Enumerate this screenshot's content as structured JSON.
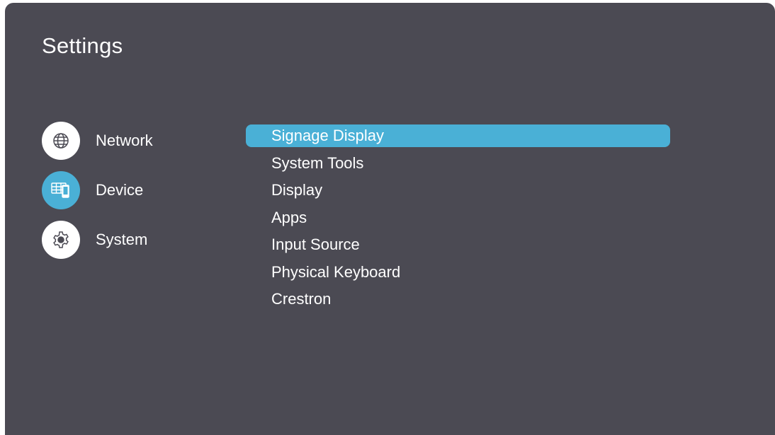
{
  "header": {
    "title": "Settings"
  },
  "sidebar": {
    "items": [
      {
        "label": "Network",
        "icon": "globe-icon",
        "active": false
      },
      {
        "label": "Device",
        "icon": "display-device-icon",
        "active": true
      },
      {
        "label": "System",
        "icon": "gear-icon",
        "active": false
      }
    ]
  },
  "menu": {
    "items": [
      {
        "label": "Signage Display",
        "selected": true
      },
      {
        "label": "System Tools"
      },
      {
        "label": "Display"
      },
      {
        "label": "Apps"
      },
      {
        "label": "Input Source"
      },
      {
        "label": "Physical Keyboard"
      },
      {
        "label": "Crestron"
      }
    ]
  },
  "colors": {
    "background": "#4b4a53",
    "accent": "#4ab0d6",
    "text": "#ffffff"
  }
}
